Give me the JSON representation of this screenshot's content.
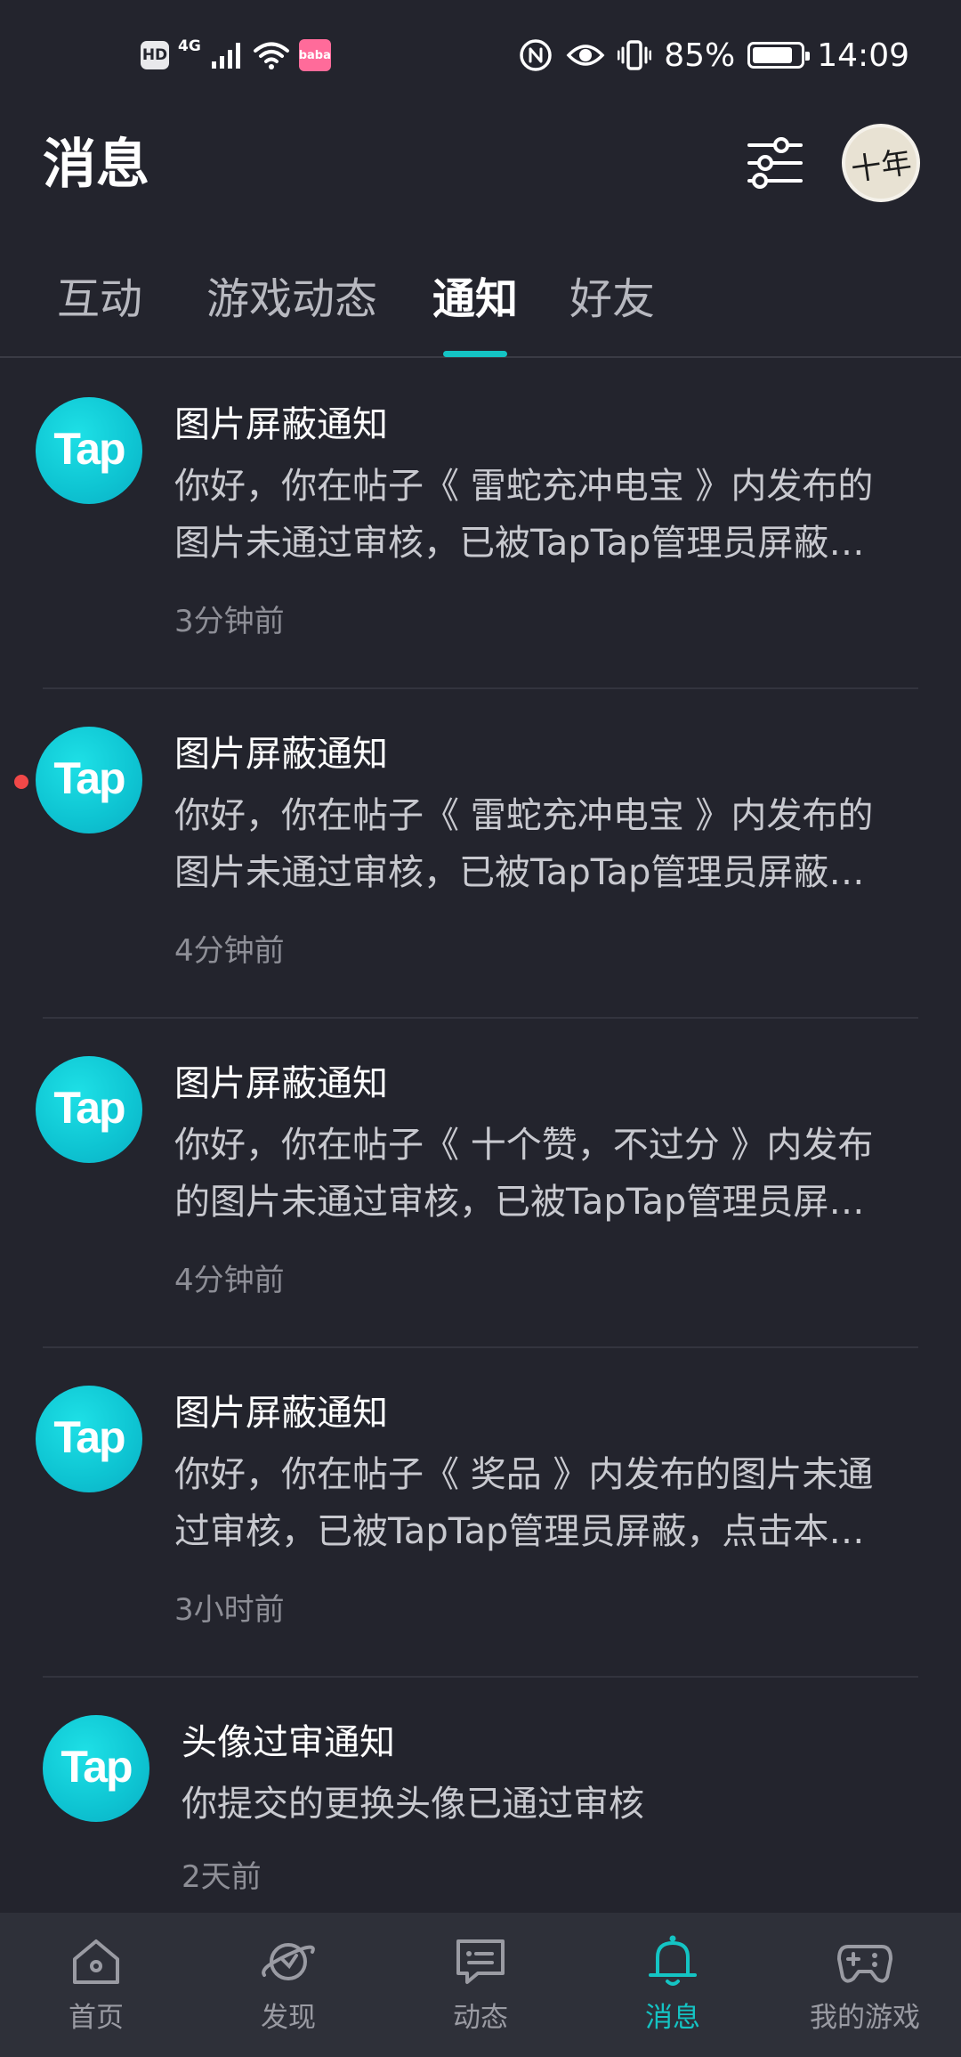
{
  "status_bar": {
    "hd_badge": "HD",
    "network": "4G",
    "app_icon_text": "baba",
    "battery": "85%",
    "battery_level": 0.85,
    "time": "14:09"
  },
  "header": {
    "title": "消息",
    "filter_icon": "sliders-icon",
    "avatar_text": "十年"
  },
  "tabs": [
    {
      "label": "互动",
      "active": false
    },
    {
      "label": "游戏动态",
      "active": false
    },
    {
      "label": "通知",
      "active": true
    },
    {
      "label": "好友",
      "active": false
    }
  ],
  "notifications": [
    {
      "logo": "Tap",
      "title": "图片屏蔽通知",
      "body": "你好，你在帖子《 雷蛇充冲电宝 》内发布的图片未通过审核，已被TapTap管理员屏蔽，点击本条消息查看详情",
      "time": "3分钟前",
      "unread": false
    },
    {
      "logo": "Tap",
      "title": "图片屏蔽通知",
      "body": "你好，你在帖子《 雷蛇充冲电宝 》内发布的图片未通过审核，已被TapTap管理员屏蔽，点击本条消息查看详情",
      "time": "4分钟前",
      "unread": true
    },
    {
      "logo": "Tap",
      "title": "图片屏蔽通知",
      "body": "你好，你在帖子《 十个赞，不过分 》内发布的图片未通过审核，已被TapTap管理员屏蔽，点击本条消息查看详情",
      "time": "4分钟前",
      "unread": false
    },
    {
      "logo": "Tap",
      "title": "图片屏蔽通知",
      "body": "你好，你在帖子《 奖品 》内发布的图片未通过审核，已被TapTap管理员屏蔽，点击本条消息查看详情",
      "time": "3小时前",
      "unread": false
    },
    {
      "logo": "Tap",
      "title": "头像过审通知",
      "body": "你提交的更换头像已通过审核",
      "time": "2天前",
      "unread": false
    }
  ],
  "bottom_nav": [
    {
      "label": "首页",
      "icon": "home-icon",
      "active": false
    },
    {
      "label": "发现",
      "icon": "planet-icon",
      "active": false
    },
    {
      "label": "动态",
      "icon": "chat-bubble-icon",
      "active": false
    },
    {
      "label": "消息",
      "icon": "bell-icon",
      "active": true
    },
    {
      "label": "我的游戏",
      "icon": "gamepad-icon",
      "active": false
    }
  ],
  "colors": {
    "background": "#23242d",
    "accent": "#14c4c4",
    "unread_dot": "#f04848",
    "nav_background": "#2e3039"
  }
}
